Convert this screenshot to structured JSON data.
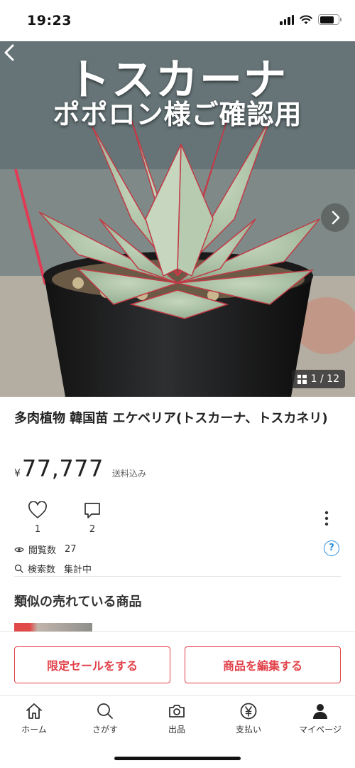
{
  "status_bar": {
    "time": "19:23"
  },
  "hero": {
    "overlay_title": "トスカーナ",
    "overlay_subtitle": "ポポロン様ご確認用",
    "page_counter": "1 / 12"
  },
  "product": {
    "title": "多肉植物 韓国苗 エケベリア(トスカーナ、トスカネリ)",
    "currency": "¥",
    "price": "77,777",
    "shipping": "送料込み"
  },
  "actions": {
    "like_count": "1",
    "comment_count": "2"
  },
  "meta": {
    "views_label": "閲覧数",
    "views_value": "27",
    "search_label": "検索数",
    "search_value": "集計中"
  },
  "similar": {
    "title": "類似の売れている商品"
  },
  "action_bar": {
    "limited_sale_label": "限定セールをする",
    "edit_item_label": "商品を編集する"
  },
  "tabs": [
    {
      "label": "ホーム",
      "icon": "home-icon"
    },
    {
      "label": "さがす",
      "icon": "search-icon"
    },
    {
      "label": "出品",
      "icon": "camera-icon"
    },
    {
      "label": "支払い",
      "icon": "yen-icon"
    },
    {
      "label": "マイページ",
      "icon": "person-icon"
    }
  ],
  "colors": {
    "accent": "#e2424a",
    "help": "#2b8fe0"
  }
}
